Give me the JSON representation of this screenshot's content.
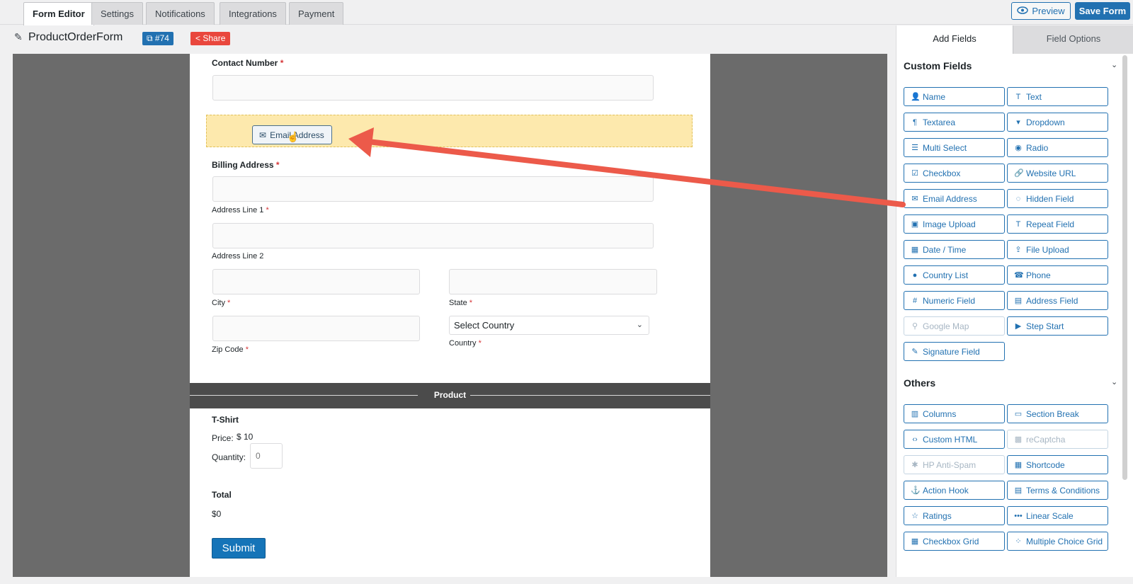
{
  "tabs": [
    "Form Editor",
    "Settings",
    "Notifications",
    "Integrations",
    "Payment"
  ],
  "header": {
    "preview": "Preview",
    "save": "Save Form"
  },
  "form": {
    "name": "ProductOrderForm",
    "id_badge": "#74",
    "share": "Share"
  },
  "canvas": {
    "contact_label": "Contact Number",
    "dragged_field": "Email Address",
    "billing_label": "Billing Address",
    "address_line1": "Address Line 1",
    "address_line2": "Address Line 2",
    "city": "City",
    "state": "State",
    "zip": "Zip Code",
    "country_select": "Select Country",
    "country": "Country",
    "product_section": "Product",
    "product_name": "T-Shirt",
    "price_label": "Price:",
    "price_value": "$ 10",
    "quantity_label": "Quantity:",
    "quantity_value": "0",
    "total_label": "Total",
    "total_value": "$0",
    "submit": "Submit"
  },
  "sidebar": {
    "tabs": [
      "Add Fields",
      "Field Options"
    ],
    "custom_title": "Custom Fields",
    "custom_fields": [
      {
        "label": "Name",
        "icon": "user-icon"
      },
      {
        "label": "Text",
        "icon": "text-icon"
      },
      {
        "label": "Textarea",
        "icon": "paragraph-icon"
      },
      {
        "label": "Dropdown",
        "icon": "dropdown-icon"
      },
      {
        "label": "Multi Select",
        "icon": "list-icon"
      },
      {
        "label": "Radio",
        "icon": "radio-icon"
      },
      {
        "label": "Checkbox",
        "icon": "checkbox-icon"
      },
      {
        "label": "Website URL",
        "icon": "link-icon"
      },
      {
        "label": "Email Address",
        "icon": "envelope-icon"
      },
      {
        "label": "Hidden Field",
        "icon": "eye-slash-icon"
      },
      {
        "label": "Image Upload",
        "icon": "image-icon"
      },
      {
        "label": "Repeat Field",
        "icon": "text-icon"
      },
      {
        "label": "Date / Time",
        "icon": "calendar-icon"
      },
      {
        "label": "File Upload",
        "icon": "upload-icon"
      },
      {
        "label": "Country List",
        "icon": "globe-icon"
      },
      {
        "label": "Phone",
        "icon": "phone-icon"
      },
      {
        "label": "Numeric Field",
        "icon": "hash-icon"
      },
      {
        "label": "Address Field",
        "icon": "address-card-icon"
      },
      {
        "label": "Google Map",
        "icon": "map-pin-icon",
        "disabled": true
      },
      {
        "label": "Step Start",
        "icon": "step-icon"
      },
      {
        "label": "Signature Field",
        "icon": "pen-square-icon"
      }
    ],
    "others_title": "Others",
    "other_fields": [
      {
        "label": "Columns",
        "icon": "columns-icon"
      },
      {
        "label": "Section Break",
        "icon": "section-icon"
      },
      {
        "label": "Custom HTML",
        "icon": "code-icon"
      },
      {
        "label": "reCaptcha",
        "icon": "qrcode-icon",
        "disabled": true
      },
      {
        "label": "HP Anti-Spam",
        "icon": "honeypot-icon",
        "disabled": true
      },
      {
        "label": "Shortcode",
        "icon": "calendar-icon"
      },
      {
        "label": "Action Hook",
        "icon": "anchor-icon"
      },
      {
        "label": "Terms & Conditions",
        "icon": "file-icon"
      },
      {
        "label": "Ratings",
        "icon": "star-icon"
      },
      {
        "label": "Linear Scale",
        "icon": "dots-icon"
      },
      {
        "label": "Checkbox Grid",
        "icon": "grid-icon"
      },
      {
        "label": "Multiple Choice Grid",
        "icon": "dots-grid-icon"
      }
    ]
  },
  "colors": {
    "accent": "#2271b1",
    "share": "#e9473d",
    "dropzone": "#fde9ad",
    "arrow": "#ec5a4a"
  }
}
